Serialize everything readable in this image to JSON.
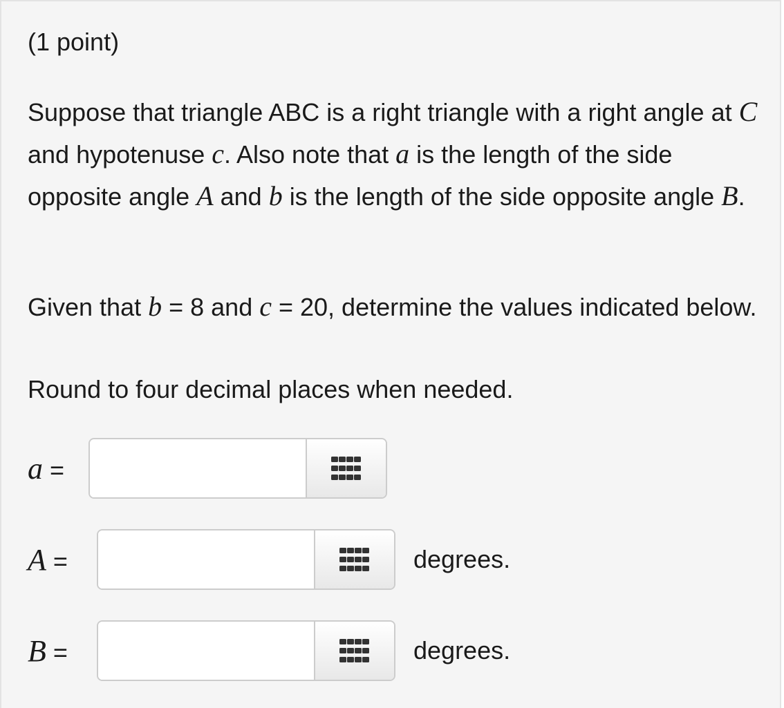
{
  "problem": {
    "points": "(1 point)",
    "statement": {
      "t1": "Suppose that triangle ABC is a right triangle with a right angle at ",
      "m1": "C",
      "t2": " and hypotenuse ",
      "m2": "c",
      "t3": ". Also note that ",
      "m3": "a",
      "t4": " is the length of the side opposite angle ",
      "m4": "A",
      "t5": " and ",
      "m5": "b",
      "t6": " is the length of the side opposite angle ",
      "m6": "B",
      "t7": "."
    },
    "given": {
      "t1": "Given that ",
      "m1": "b",
      "t2": " = 8 and ",
      "m2": "c",
      "t3": " = 20, determine the values indicated below."
    },
    "rounding": "Round to four decimal places when needed."
  },
  "answers": [
    {
      "var": "a",
      "eq": " =",
      "value": "",
      "unit": ""
    },
    {
      "var": "A",
      "eq": " =",
      "value": "",
      "unit": "degrees."
    },
    {
      "var": "B",
      "eq": " =",
      "value": "",
      "unit": "degrees."
    }
  ],
  "icons": {
    "palette": "grid-dots-icon"
  },
  "colors": {
    "panel_bg": "#f5f5f5",
    "border": "#cccccc"
  }
}
